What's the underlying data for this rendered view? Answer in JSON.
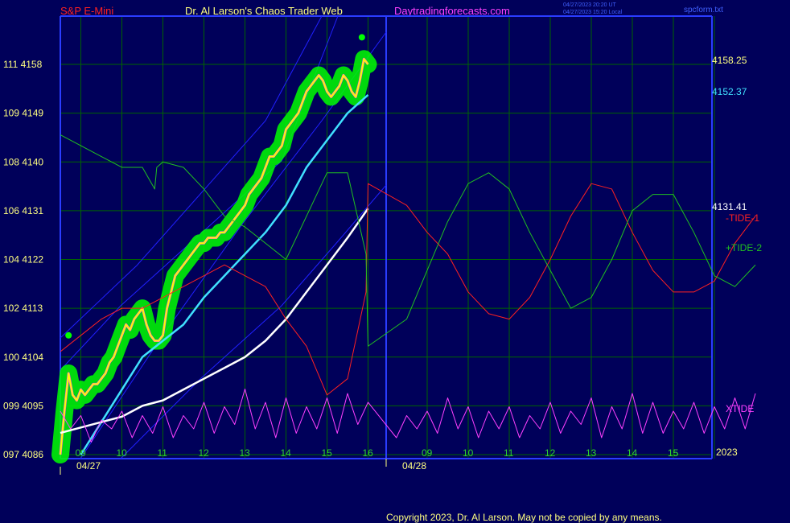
{
  "header": {
    "left": "S&P E-Mini",
    "center": "Dr. Al Larson's Chaos Trader Web",
    "right": "Daytradingforecasts.com",
    "timestamp_utc": "04/27/2023 20:20 UT",
    "timestamp_local": "04/27/2023 15:20 Local",
    "file": "spcform.txt"
  },
  "footer": {
    "copyright": "Copyright 2023, Dr. Al Larson. May not be copied by any means."
  },
  "colors": {
    "background": "#00005a",
    "frame": "#2a3cff",
    "grid": "#006400",
    "price": "#ffff00",
    "fast_ma": "#40e0ff",
    "slow_ma": "#ffffff",
    "tide1": "#ff2020",
    "tide2": "#20c020",
    "xtide": "#ff40ff",
    "trend_bands": "#2020ff",
    "highlight": "#00ff00",
    "header_left": "#ff2020",
    "header_center": "#ffff80",
    "header_right": "#ff40ff",
    "header_file": "#4060ff"
  },
  "chart_data": {
    "type": "line",
    "ylim": [
      4086,
      4163
    ],
    "xlim": [
      8.5,
      17.0
    ],
    "y_ticks": [
      {
        "label": "111  4158",
        "value": 4158
      },
      {
        "label": "109  4149",
        "value": 4149
      },
      {
        "label": "108  4140",
        "value": 4140
      },
      {
        "label": "106  4131",
        "value": 4131
      },
      {
        "label": "104  4122",
        "value": 4122
      },
      {
        "label": "102  4113",
        "value": 4113
      },
      {
        "label": "100  4104",
        "value": 4104
      },
      {
        "label": "099  4095",
        "value": 4095
      },
      {
        "label": "097  4086",
        "value": 4086
      }
    ],
    "x_ticks": [
      {
        "label": "09",
        "hour": 9
      },
      {
        "label": "10",
        "hour": 10
      },
      {
        "label": "11",
        "hour": 11
      },
      {
        "label": "12",
        "hour": 12
      },
      {
        "label": "13",
        "hour": 13
      },
      {
        "label": "14",
        "hour": 14
      },
      {
        "label": "15",
        "hour": 15
      },
      {
        "label": "16",
        "hour": 16
      },
      {
        "label": "09",
        "hour": 9
      },
      {
        "label": "10",
        "hour": 10
      },
      {
        "label": "11",
        "hour": 11
      },
      {
        "label": "12",
        "hour": 12
      },
      {
        "label": "13",
        "hour": 13
      },
      {
        "label": "14",
        "hour": 14
      },
      {
        "label": "15",
        "hour": 15
      },
      {
        "label": "15",
        "hour": 15
      }
    ],
    "x_axis_suffix": "2023",
    "date_labels": [
      "04/27",
      "04/28"
    ],
    "right_labels": {
      "last_price": "4158.25",
      "fast_ma": "4152.37",
      "slow_ma": "4131.41",
      "tide1": "-TIDE-1",
      "tide2": "+TIDE-2",
      "xtide": "XTIDE"
    },
    "series": [
      {
        "name": "price",
        "x": [
          8.5,
          8.6,
          8.7,
          8.8,
          8.9,
          9.0,
          9.1,
          9.2,
          9.3,
          9.4,
          9.5,
          9.6,
          9.7,
          9.8,
          9.9,
          10.0,
          10.1,
          10.2,
          10.3,
          10.4,
          10.5,
          10.6,
          10.7,
          10.8,
          10.9,
          11.0,
          11.1,
          11.2,
          11.3,
          11.4,
          11.5,
          11.6,
          11.7,
          11.8,
          11.9,
          12.0,
          12.1,
          12.2,
          12.3,
          12.4,
          12.5,
          12.6,
          12.7,
          12.8,
          12.9,
          13.0,
          13.1,
          13.2,
          13.3,
          13.4,
          13.5,
          13.6,
          13.7,
          13.8,
          13.9,
          14.0,
          14.1,
          14.2,
          14.3,
          14.4,
          14.5,
          14.6,
          14.7,
          14.8,
          14.9,
          15.0,
          15.1,
          15.2,
          15.3,
          15.4,
          15.5,
          15.6,
          15.7,
          15.8,
          15.9,
          16.0
        ],
        "y": [
          4086,
          4094,
          4101,
          4097,
          4096,
          4098,
          4097,
          4098,
          4099,
          4099,
          4100,
          4101,
          4103,
          4104,
          4106,
          4108,
          4110,
          4109,
          4111,
          4112,
          4113,
          4110,
          4108,
          4107,
          4107,
          4108,
          4113,
          4116,
          4119,
          4120,
          4121,
          4122,
          4123,
          4124,
          4125,
          4125,
          4126,
          4126,
          4126,
          4127,
          4127,
          4128,
          4129,
          4130,
          4131,
          4132,
          4134,
          4135,
          4136,
          4137,
          4139,
          4141,
          4141,
          4142,
          4143,
          4146,
          4147,
          4148,
          4149,
          4151,
          4153,
          4154,
          4155,
          4156,
          4155,
          4153,
          4152,
          4153,
          4154,
          4156,
          4155,
          4153,
          4152,
          4155,
          4159,
          4158
        ]
      },
      {
        "name": "fast moving average",
        "x": [
          9.0,
          9.5,
          10.0,
          10.5,
          11.0,
          11.5,
          12.0,
          12.5,
          13.0,
          13.5,
          14.0,
          14.5,
          15.0,
          15.5,
          16.0
        ],
        "y": [
          4086,
          4092,
          4098,
          4104,
          4107,
          4110,
          4115,
          4119,
          4123,
          4127,
          4132,
          4139,
          4144,
          4149,
          4152.37
        ]
      },
      {
        "name": "slow moving average",
        "x": [
          8.5,
          9.0,
          9.5,
          10.0,
          10.5,
          11.0,
          11.5,
          12.0,
          12.5,
          13.0,
          13.5,
          14.0,
          14.5,
          15.0,
          15.5,
          16.0
        ],
        "y": [
          4090,
          4091,
          4092,
          4093,
          4095,
          4096,
          4098,
          4100,
          4102,
          4104,
          4107,
          4111,
          4116,
          4121,
          4126,
          4131.41
        ]
      },
      {
        "name": "-TIDE-1",
        "x": [
          8.5,
          9.0,
          9.5,
          10.0,
          10.5,
          11.0,
          11.5,
          12.0,
          12.5,
          13.0,
          13.5,
          14.0,
          14.5,
          15.0,
          15.5,
          15.95,
          16.0,
          16.5,
          17.0,
          17.5,
          18.0,
          18.5,
          19.0,
          19.5,
          20.0,
          20.5,
          21.0,
          21.5,
          22.0,
          22.5,
          23.0,
          23.5,
          24.0,
          24.5,
          25.0
        ],
        "y": [
          4105,
          4108,
          4111,
          4113,
          4113,
          4115,
          4117,
          4119,
          4121,
          4119,
          4117,
          4111,
          4106,
          4097,
          4100,
          4116,
          4136,
          4132,
          4127,
          4123,
          4116,
          4112,
          4111,
          4115,
          4122,
          4130,
          4136,
          4135,
          4127,
          4120,
          4116,
          4116,
          4118,
          4125,
          4130
        ]
      },
      {
        "name": "+TIDE-2",
        "x": [
          8.5,
          9.0,
          9.5,
          10.0,
          10.5,
          10.8,
          10.85,
          11.0,
          11.5,
          12.0,
          12.5,
          13.0,
          13.5,
          14.0,
          14.5,
          15.0,
          15.5,
          15.95,
          16.0,
          16.5,
          17.0,
          17.5,
          18.0,
          18.5,
          19.0,
          19.5,
          20.0,
          20.5,
          21.0,
          21.5,
          22.0,
          22.5,
          23.0,
          23.5,
          24.0,
          24.5,
          25.0
        ],
        "y": [
          4145,
          4143,
          4141,
          4139,
          4139,
          4135,
          4139,
          4140,
          4139,
          4135,
          4130,
          4128,
          4125,
          4122,
          4130,
          4138,
          4138,
          4123,
          4106,
          4111,
          4120,
          4129,
          4136,
          4138,
          4135,
          4127,
          4120,
          4113,
          4115,
          4122,
          4131,
          4134,
          4134,
          4127,
          4119,
          4117,
          4121
        ]
      },
      {
        "name": "XTIDE",
        "x": [
          8.5,
          8.75,
          9.0,
          9.25,
          9.5,
          9.75,
          10.0,
          10.25,
          10.5,
          10.75,
          11.0,
          11.25,
          11.5,
          11.75,
          12.0,
          12.25,
          12.5,
          12.75,
          13.0,
          13.25,
          13.5,
          13.75,
          14.0,
          14.25,
          14.5,
          14.75,
          15.0,
          15.25,
          15.5,
          15.75,
          16.0,
          16.25,
          16.5,
          16.75,
          17.0,
          17.25,
          17.5,
          17.75,
          18.0,
          18.25,
          18.5,
          18.75,
          19.0,
          19.25,
          19.5,
          19.75,
          20.0,
          20.25,
          20.5,
          20.75,
          21.0,
          21.25,
          21.5,
          21.75,
          22.0,
          22.25,
          22.5,
          22.75,
          23.0,
          23.25,
          23.5,
          23.75,
          24.0,
          24.25,
          24.5,
          24.75,
          25.0
        ],
        "y": [
          4094,
          4090,
          4093,
          4087,
          4092,
          4090,
          4094,
          4088,
          4093,
          4089,
          4095,
          4088,
          4093,
          4090,
          4096,
          4089,
          4095,
          4091,
          4099,
          4090,
          4096,
          4088,
          4097,
          4089,
          4095,
          4090,
          4097,
          4089,
          4098,
          4091,
          4096,
          4088,
          4093,
          4090,
          4094,
          4089,
          4097,
          4090,
          4095,
          4088,
          4094,
          4090,
          4095,
          4088,
          4093,
          4090,
          4096,
          4089,
          4094,
          4091,
          4097,
          4088,
          4095,
          4090,
          4098,
          4089,
          4096,
          4089,
          4094,
          4090,
          4096,
          4089,
          4095,
          4090,
          4097,
          4090,
          4098
        ]
      }
    ]
  }
}
